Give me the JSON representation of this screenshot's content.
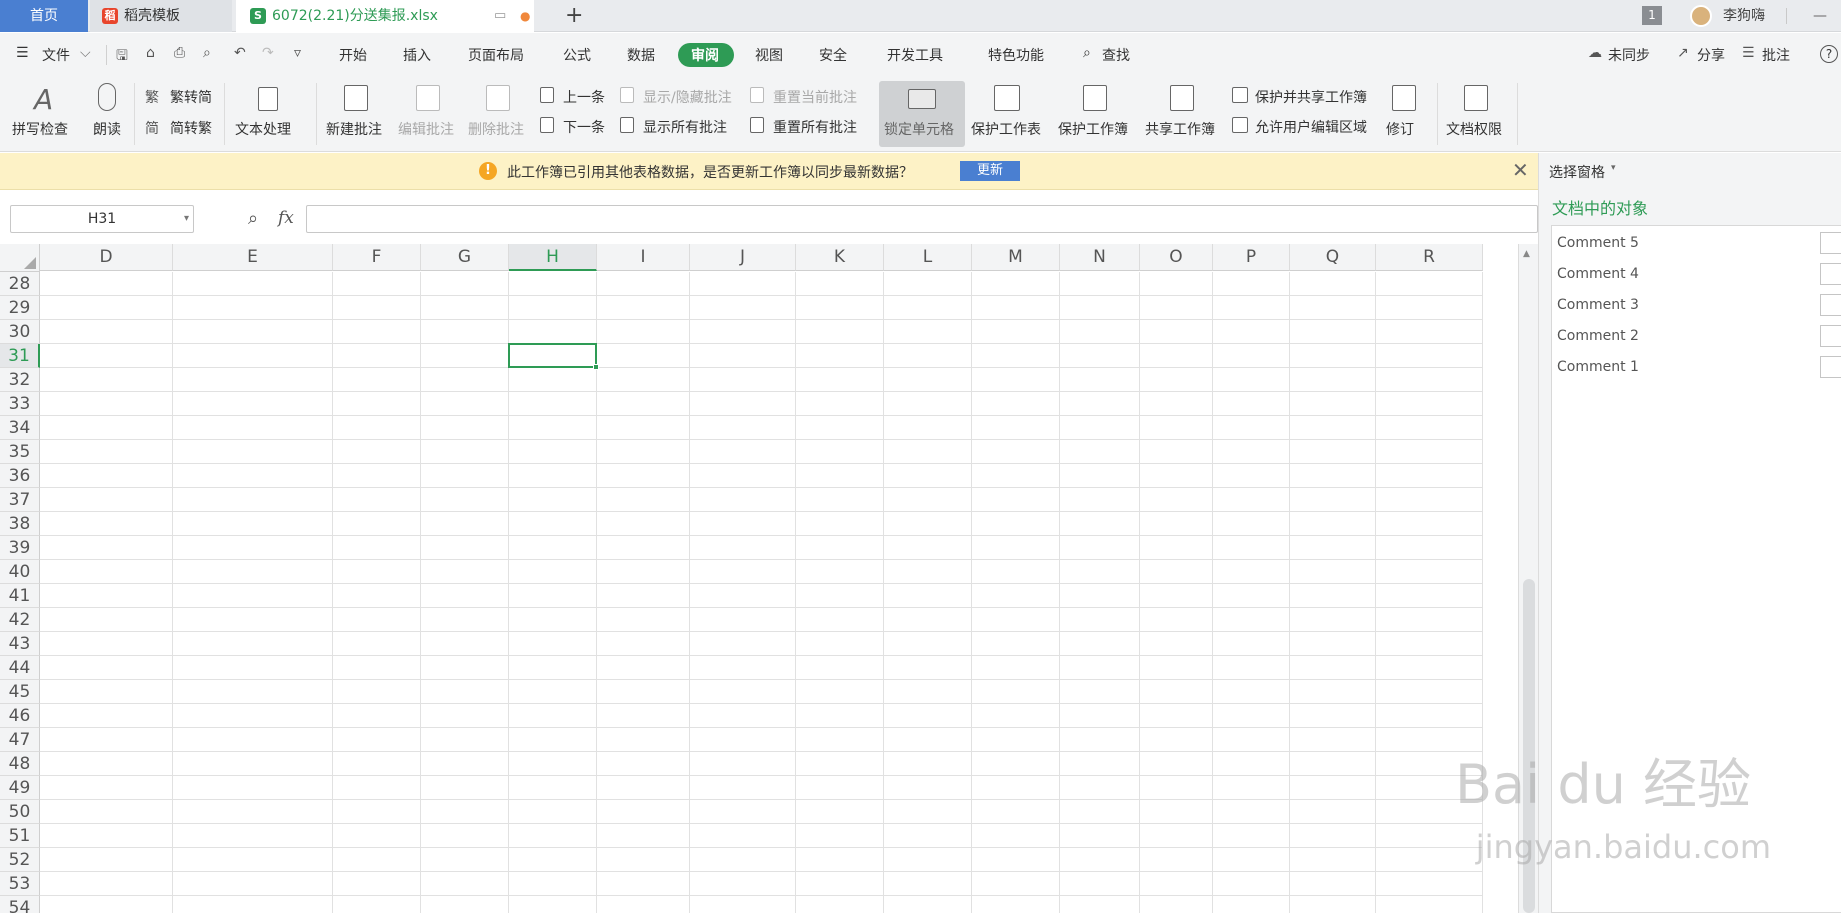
{
  "tabs": {
    "home": "首页",
    "template": "稻壳模板",
    "file": "6072(2.21)分送集报.xlsx",
    "window_count": "1",
    "user": "李狗嗨",
    "new_tab": "+"
  },
  "menu": {
    "file": "文件",
    "items": [
      "开始",
      "插入",
      "页面布局",
      "公式",
      "数据",
      "审阅",
      "视图",
      "安全",
      "开发工具",
      "特色功能"
    ],
    "active": "审阅",
    "search": "查找",
    "sync": "未同步",
    "share": "分享",
    "comment": "批注",
    "help": "?"
  },
  "ribbon": {
    "spellcheck": "拼写检查",
    "read": "朗读",
    "trad_to_simp": "繁转简",
    "simp_to_trad": "简转繁",
    "text_proc": "文本处理",
    "new_comment": "新建批注",
    "edit_comment": "编辑批注",
    "delete_comment": "删除批注",
    "prev": "上一条",
    "next": "下一条",
    "show_hide_comment": "显示/隐藏批注",
    "show_all_comments": "显示所有批注",
    "reset_current_comment": "重置当前批注",
    "reset_all_comments": "重置所有批注",
    "lock_cell": "锁定单元格",
    "protect_sheet": "保护工作表",
    "protect_book": "保护工作簿",
    "share_book": "共享工作簿",
    "protect_and_share": "保护并共享工作簿",
    "allow_edit_range": "允许用户编辑区域",
    "revise": "修订",
    "doc_rights": "文档权限"
  },
  "notice": {
    "message": "此工作簿已引用其他表格数据，是否更新工作簿以同步最新数据？",
    "button": "更新",
    "accent": "#f5a623"
  },
  "formula_bar": {
    "name_box": "H31",
    "fx": "fx",
    "value": ""
  },
  "grid": {
    "columns": [
      "D",
      "E",
      "F",
      "G",
      "H",
      "I",
      "J",
      "K",
      "L",
      "M",
      "N",
      "O",
      "P",
      "Q",
      "R"
    ],
    "rows": [
      "28",
      "29",
      "30",
      "31",
      "32",
      "33",
      "34",
      "35",
      "36",
      "37",
      "38",
      "39",
      "40",
      "41",
      "42",
      "43",
      "44",
      "45",
      "46",
      "47",
      "48",
      "49",
      "50",
      "51",
      "52",
      "53",
      "54"
    ],
    "selected_col": "H",
    "selected_row": "31",
    "accent": "#2e9b55"
  },
  "pane": {
    "title": "选择窗格",
    "subtitle": "文档中的对象",
    "items": [
      "Comment 5",
      "Comment 4",
      "Comment 3",
      "Comment 2",
      "Comment 1"
    ]
  },
  "watermark": {
    "line1": "Bai du 经验",
    "line2": "jingyan.baidu.com"
  }
}
